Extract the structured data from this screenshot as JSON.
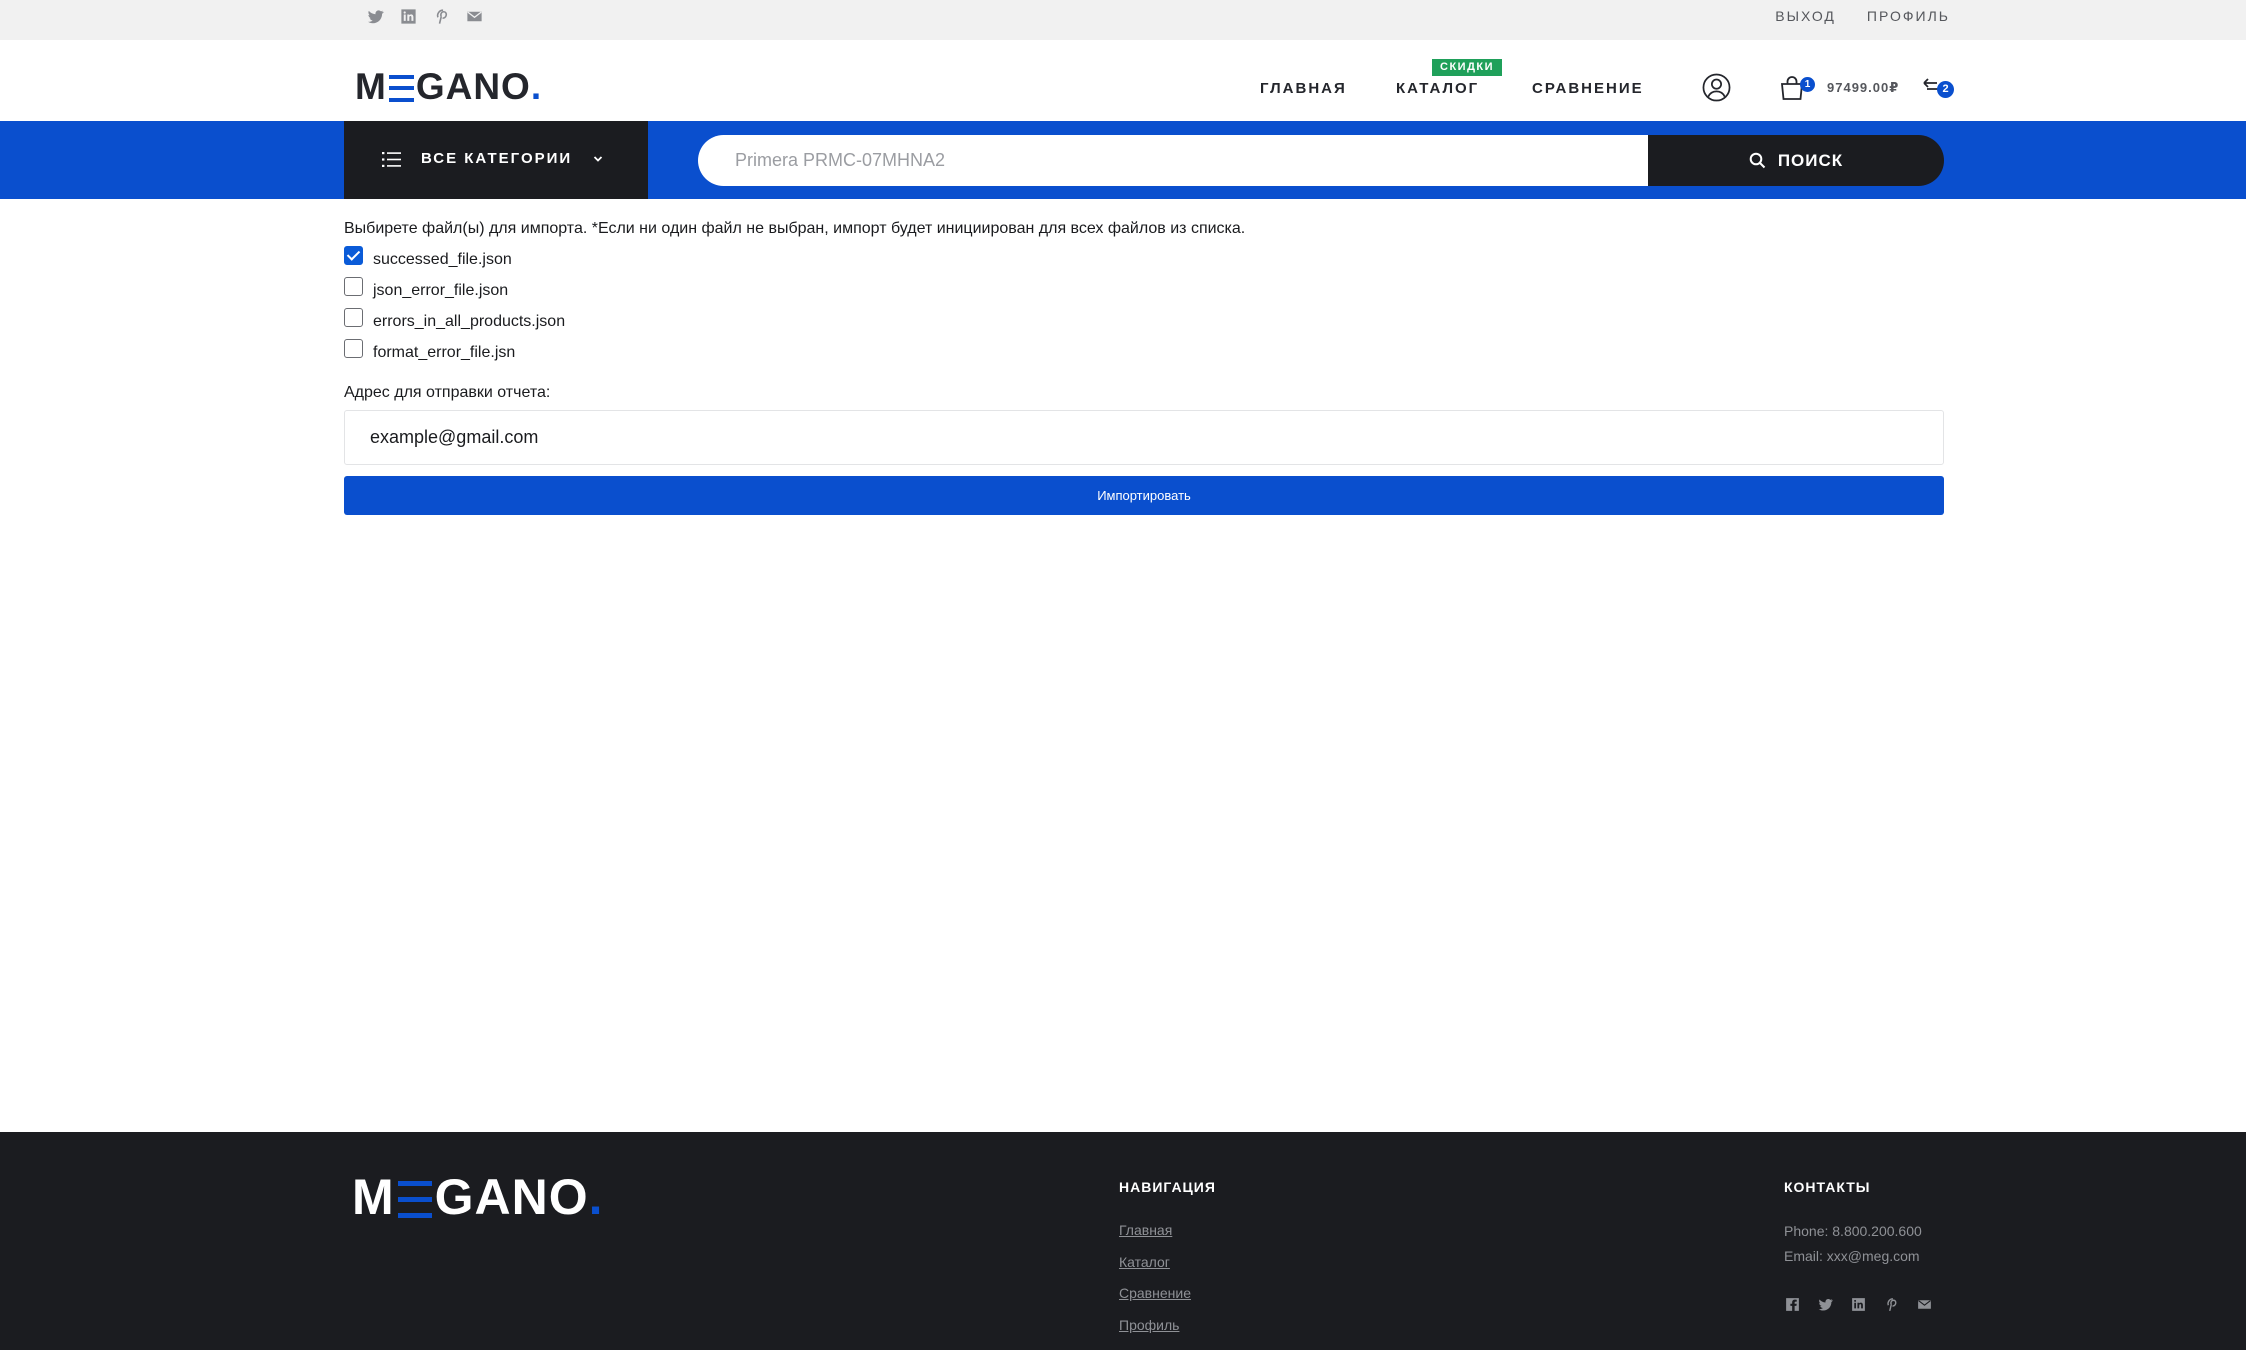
{
  "topbar": {
    "social": [
      "twitter-icon",
      "linkedin-icon",
      "pinterest-icon",
      "mail-icon"
    ],
    "logout": "ВЫХОД",
    "profile": "ПРОФИЛЬ"
  },
  "header": {
    "logo": {
      "before": "M",
      "after": "GANO",
      "dot": "."
    },
    "nav": {
      "home": "ГЛАВНАЯ",
      "catalog": "КАТАЛОГ",
      "catalog_badge": "СКИДКИ",
      "compare": "СРАВНЕНИЕ"
    },
    "cart": {
      "count": "1",
      "total": "97499.00₽"
    },
    "compare_count": "2"
  },
  "search": {
    "categories_label": "ВСЕ КАТЕГОРИИ",
    "placeholder": "Primera PRMC-07MHNA2",
    "button": "ПОИСК"
  },
  "import_form": {
    "intro": "Выбирете файл(ы) для импорта. *Если ни один файл не выбран, импорт будет инициирован для всех файлов из списка.",
    "files": [
      {
        "name": "successed_file.json",
        "checked": true
      },
      {
        "name": "json_error_file.json",
        "checked": false
      },
      {
        "name": "errors_in_all_products.json",
        "checked": false
      },
      {
        "name": "format_error_file.jsn",
        "checked": false
      }
    ],
    "email_label": "Адрес для отправки отчета:",
    "email_value": "example@gmail.com",
    "submit": "Импортировать"
  },
  "footer": {
    "logo": {
      "before": "M",
      "after": "GANO",
      "dot": "."
    },
    "nav_title": "НАВИГАЦИЯ",
    "nav_links": [
      "Главная",
      "Каталог",
      "Сравнение",
      "Профиль"
    ],
    "contacts_title": "КОНТАКТЫ",
    "phone": "Phone: 8.800.200.600",
    "email": "Email: xxx@meg.com",
    "social": [
      "facebook-icon",
      "twitter-icon",
      "linkedin-icon",
      "pinterest-icon",
      "mail-icon"
    ]
  },
  "colors": {
    "brand_blue": "#0a4fce",
    "dark": "#1b1c20",
    "badge_green": "#1fa05a"
  }
}
